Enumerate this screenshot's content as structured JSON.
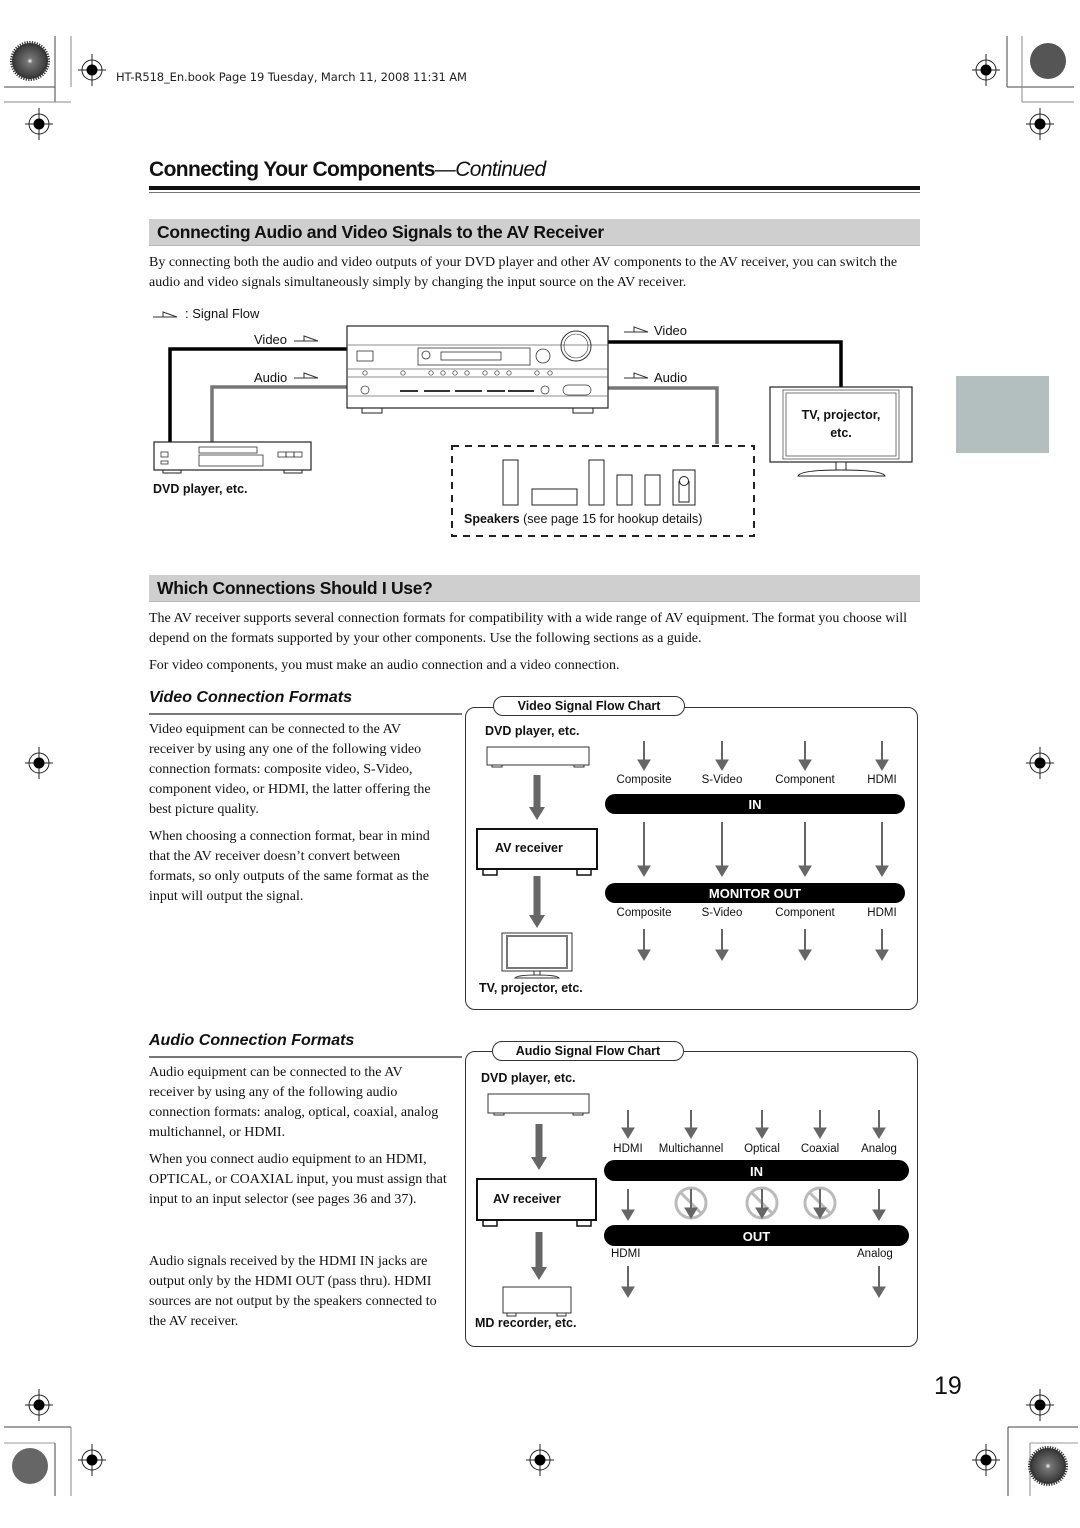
{
  "print_header": "HT-R518_En.book  Page 19  Tuesday, March 11, 2008  11:31 AM",
  "chapter": {
    "title": "Connecting Your Components",
    "suffix": "—Continued"
  },
  "section1": {
    "heading": "Connecting Audio and Video Signals to the AV Receiver",
    "body": "By connecting both the audio and video outputs of your DVD player and other AV components to the AV receiver, you can switch the audio and video signals simultaneously simply by changing the input source on the AV receiver.",
    "diagram": {
      "legend": ": Signal Flow",
      "video_in_label": "Video",
      "audio_in_label": "Audio",
      "video_out_label": "Video",
      "audio_out_label": "Audio",
      "tv_label_line1": "TV, projector,",
      "tv_label_line2": "etc.",
      "dvd_label": "DVD player, etc.",
      "speakers_label_bold": "Speakers",
      "speakers_label_rest": " (see page 15 for hookup details)"
    }
  },
  "section2": {
    "heading": "Which Connections Should I Use?",
    "body1": "The AV receiver supports several connection formats for compatibility with a wide range of AV equipment. The format you choose will depend on the formats supported by your other components. Use the following sections as a guide.",
    "body2": "For video components, you must make an audio connection and a video connection."
  },
  "video_formats": {
    "heading": "Video Connection Formats",
    "para1": "Video equipment can be connected to the AV receiver by using any one of the following video connection formats: composite video, S-Video, component video, or HDMI, the latter offering the best picture quality.",
    "para2": "When choosing a connection format, bear in mind that the AV receiver doesn’t convert between formats, so only outputs of the same format as the input will output the signal.",
    "chart": {
      "title": "Video Signal Flow Chart",
      "source": "DVD player, etc.",
      "receiver": "AV receiver",
      "destination": "TV, projector, etc.",
      "in_bar": "IN",
      "out_bar": "MONITOR OUT",
      "inputs": [
        "Composite",
        "S-Video",
        "Component",
        "HDMI"
      ],
      "outputs": [
        "Composite",
        "S-Video",
        "Component",
        "HDMI"
      ]
    }
  },
  "audio_formats": {
    "heading": "Audio Connection Formats",
    "para1": "Audio equipment can be connected to the AV receiver by using any of the following audio connection formats: analog, optical, coaxial, analog multichannel, or HDMI.",
    "para2": "When you connect audio equipment to an HDMI, OPTICAL, or COAXIAL input, you must assign that input to an input selector (see pages 36 and 37).",
    "para3": "Audio signals received by the HDMI IN jacks are output only by the HDMI OUT (pass thru). HDMI sources are not output by the speakers connected to the AV receiver.",
    "chart": {
      "title": "Audio Signal Flow Chart",
      "source": "DVD player, etc.",
      "receiver": "AV receiver",
      "destination": "MD recorder, etc.",
      "in_bar": "IN",
      "out_bar": "OUT",
      "inputs": [
        "HDMI",
        "Multichannel",
        "Optical",
        "Coaxial",
        "Analog"
      ],
      "passthrough": [
        true,
        false,
        false,
        false,
        true
      ],
      "outputs": [
        "HDMI",
        "Analog"
      ]
    }
  },
  "page_number": "19"
}
